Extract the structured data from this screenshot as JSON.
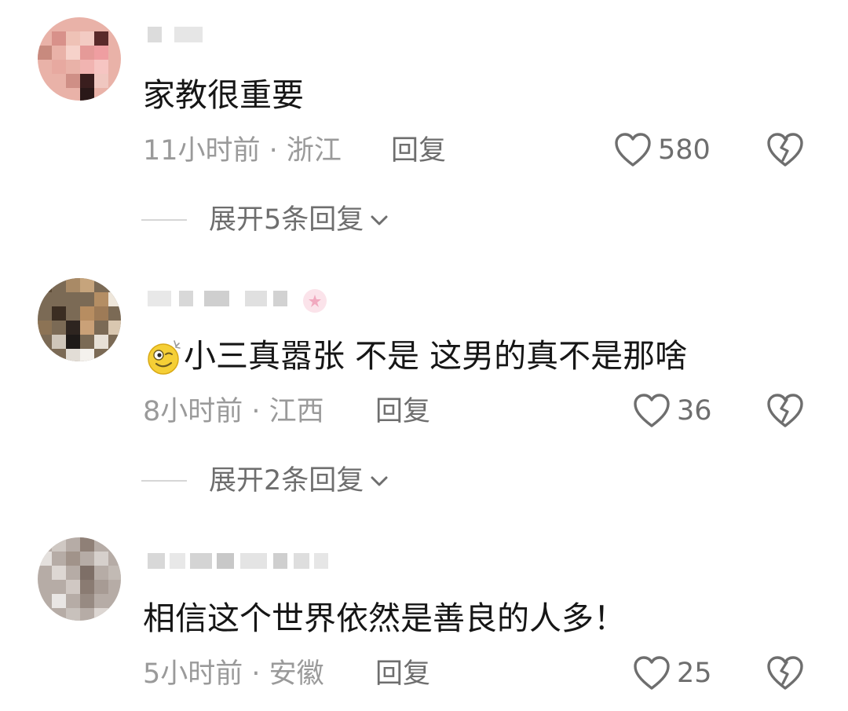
{
  "comments": [
    {
      "text": "家教很重要",
      "time_location": "11小时前 · 浙江",
      "reply_label": "回复",
      "likes": "580",
      "expand_label": "展开5条回复"
    },
    {
      "text": "小三真嚣张 不是  这男的真不是那啥",
      "emoji": "wink-emoji",
      "time_location": "8小时前 · 江西",
      "reply_label": "回复",
      "likes": "36",
      "expand_label": "展开2条回复"
    },
    {
      "text": "相信这个世界依然是善良的人多！",
      "time_location": "5小时前 · 安徽",
      "reply_label": "回复",
      "likes": "25"
    }
  ],
  "icons": {
    "like": "heart-outline-icon",
    "dislike": "broken-heart-icon",
    "expand": "chevron-down-icon"
  },
  "colors": {
    "text": "#161616",
    "meta": "#9a9a9a",
    "action": "#6e6e6e",
    "divider": "#d6d6d6"
  }
}
